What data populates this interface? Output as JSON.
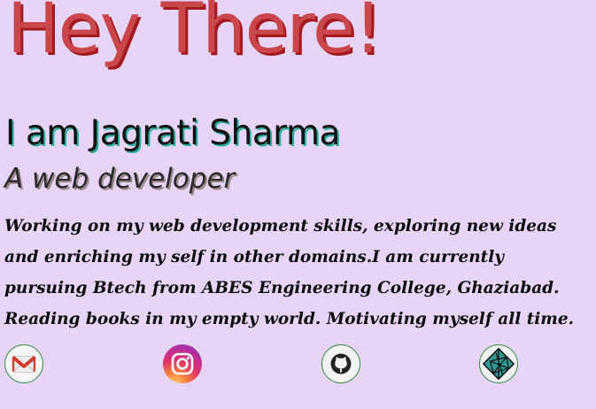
{
  "hero": {
    "greeting": "Hey There!",
    "name_line": "I am Jagrati Sharma",
    "role": "A web developer",
    "bio": "Working on my web development skills, exploring new ideas and enriching my self in other domains.I am currently pursuing Btech from ABES Engineering College, Ghaziabad. Reading books in my empty world. Motivating myself all time."
  },
  "socials": [
    {
      "icon": "gmail-icon"
    },
    {
      "icon": "instagram-icon"
    },
    {
      "icon": "github-icon"
    },
    {
      "icon": "netlify-icon"
    }
  ],
  "colors": {
    "background": "#e6d5f6",
    "greeting": "#c9464a",
    "greeting_shadow": "#a3191c",
    "name_shadow": "#2bb0a0",
    "text": "#111111"
  }
}
